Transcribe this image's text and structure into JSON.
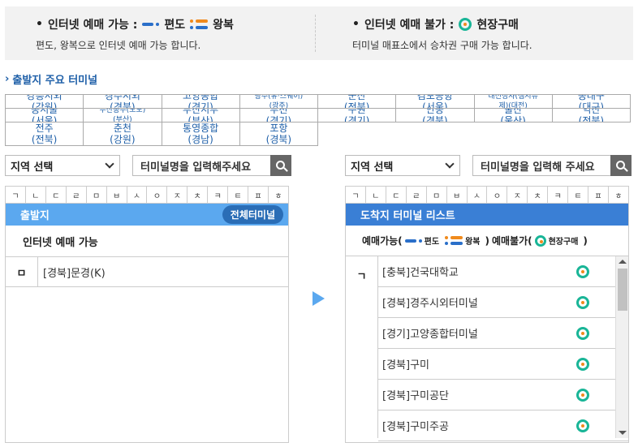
{
  "info": {
    "available": {
      "bullet": "•",
      "title": "인터넷 예매 가능 :",
      "oneway": "편도",
      "roundtrip": "왕복",
      "desc": "편도, 왕복으로 인터넷 예매 가능 합니다."
    },
    "unavailable": {
      "bullet": "•",
      "title": "인터넷 예매 불가 :",
      "onsite": "현장구매",
      "desc": "터미널 매표소에서 승차권 구매 가능 합니다."
    }
  },
  "major_section": {
    "chevron": "›",
    "title": "출발지 주요 터미널"
  },
  "major_terminals": [
    {
      "line1": "강릉시외",
      "line2": "(강원)",
      "small": false
    },
    {
      "line1": "경주시외",
      "line2": "(경북)",
      "small": false
    },
    {
      "line1": "고양종합",
      "line2": "(경기)",
      "small": false
    },
    {
      "line1": "광주(유·스퀘어)",
      "line2": "(광주)",
      "small": true
    },
    {
      "line1": "군산",
      "line2": "(전북)",
      "small": false
    },
    {
      "line1": "김포공항",
      "line2": "(서울)",
      "small": false
    },
    {
      "line1": "대전청사(샘시뮤",
      "line2": "제)(대전)",
      "small": true
    },
    {
      "line1": "동대구",
      "line2": "(대구)",
      "small": false
    },
    {
      "line1": "동서울",
      "line2": "(서울)",
      "small": false
    },
    {
      "line1": "부산동부(노포)",
      "line2": "(부산)",
      "small": true
    },
    {
      "line1": "부산서부",
      "line2": "(부산)",
      "small": false
    },
    {
      "line1": "부천",
      "line2": "(경기)",
      "small": false
    },
    {
      "line1": "수원",
      "line2": "(경기)",
      "small": false
    },
    {
      "line1": "안동",
      "line2": "(경북)",
      "small": false
    },
    {
      "line1": "울산",
      "line2": "(울산)",
      "small": false
    },
    {
      "line1": "익산",
      "line2": "(전북)",
      "small": false
    },
    {
      "line1": "전주",
      "line2": "(전북)",
      "small": false
    },
    {
      "line1": "춘천",
      "line2": "(강원)",
      "small": false
    },
    {
      "line1": "통영종합",
      "line2": "(경남)",
      "small": false
    },
    {
      "line1": "포항",
      "line2": "(경북)",
      "small": false
    }
  ],
  "consonants": [
    "ㄱ",
    "ㄴ",
    "ㄷ",
    "ㄹ",
    "ㅁ",
    "ㅂ",
    "ㅅ",
    "ㅇ",
    "ㅈ",
    "ㅊ",
    "ㅋ",
    "ㅌ",
    "ㅍ",
    "ㅎ"
  ],
  "departure": {
    "region_select": "지역 선택",
    "search_placeholder": "터미널명을 입력해주세요",
    "header": "출발지",
    "all_button": "전체터미널",
    "subheader": "인터넷 예매 가능",
    "rows": [
      {
        "index": "ㅁ",
        "name": "[경북]문경(K)"
      }
    ]
  },
  "arrival": {
    "region_select": "지역 선택",
    "search_placeholder": "터미널명을 입력해 주세요",
    "header": "도착지 터미널 리스트",
    "legend": {
      "available": "예매가능(",
      "oneway": "편도",
      "roundtrip": "왕복",
      "close_open": ")",
      "unavailable": "예매불가(",
      "onsite": "현장구매",
      "close_end": ")"
    },
    "index": "ㄱ",
    "items": [
      {
        "name": "[충북]건국대학교",
        "status": "onsite-icon"
      },
      {
        "name": "[경북]경주시외터미널",
        "status": "onsite-icon"
      },
      {
        "name": "[경기]고양종합터미널",
        "status": "onsite-icon"
      },
      {
        "name": "[경북]구미",
        "status": "onsite-icon"
      },
      {
        "name": "[경북]구미공단",
        "status": "onsite-icon"
      },
      {
        "name": "[경북]구미주공",
        "status": "onsite-icon"
      }
    ]
  }
}
